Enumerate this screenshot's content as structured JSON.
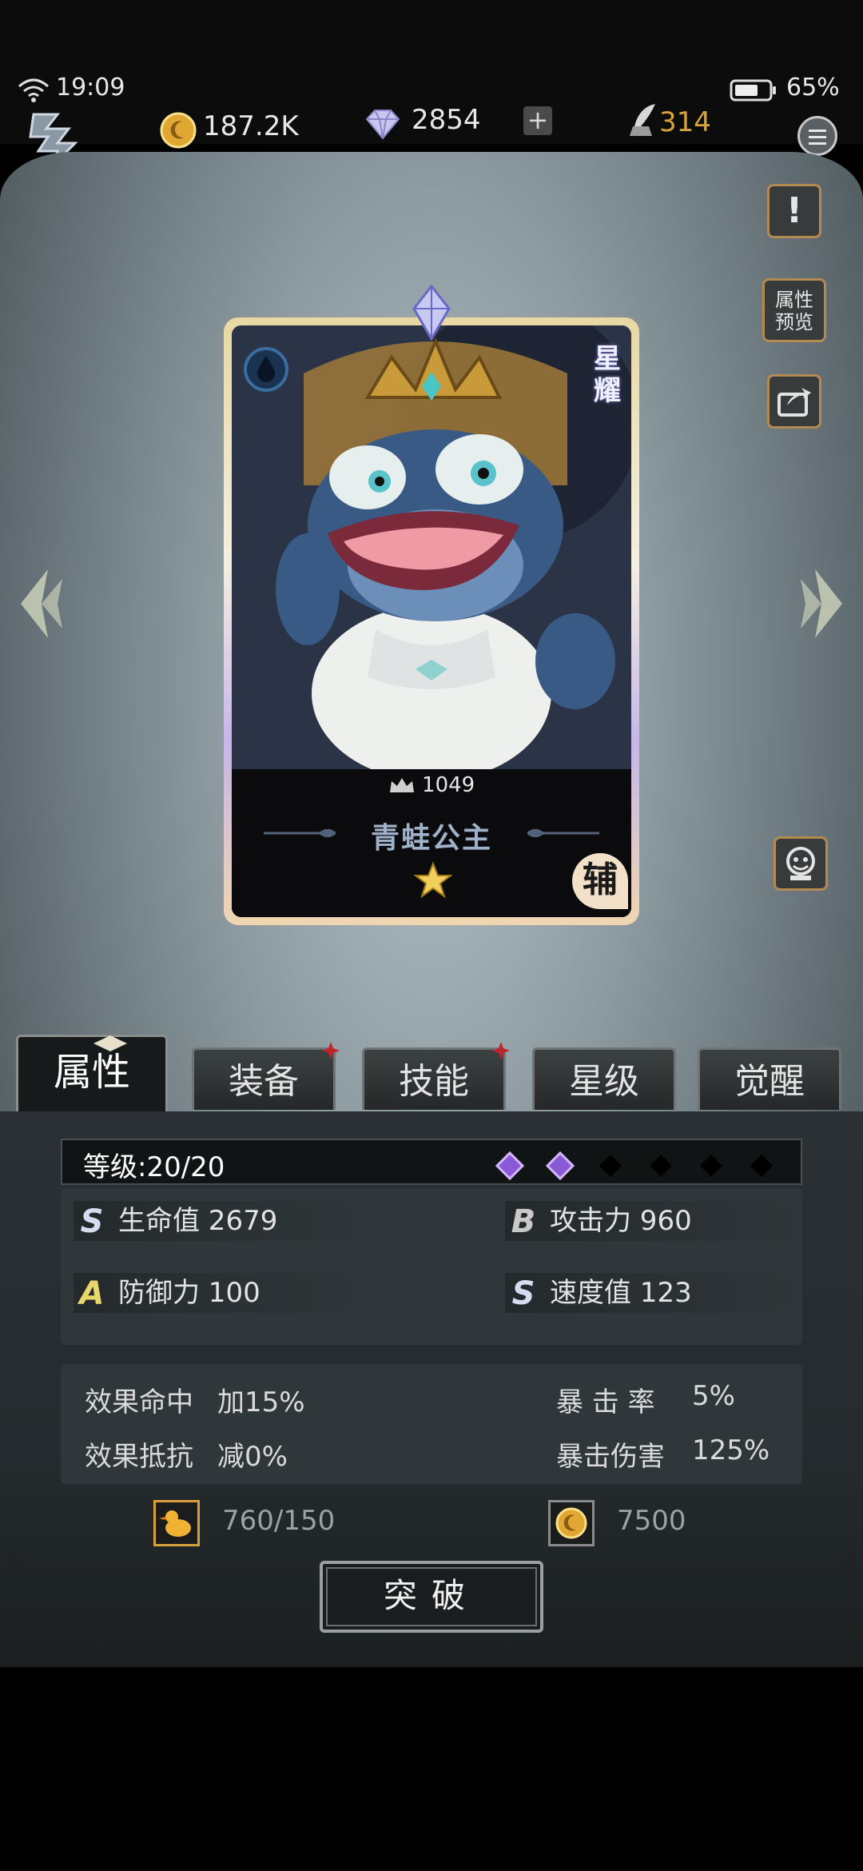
{
  "status_bar": {
    "time": "19:09",
    "battery": "65%"
  },
  "currency": {
    "gold": "187.2K",
    "gems": "2854",
    "add_label": "+",
    "stamina": "314"
  },
  "side_buttons": {
    "info_label": "!",
    "preview_label": "属性\n预览"
  },
  "hero": {
    "name": "青蛙公主",
    "power": "1049",
    "rarity_badge": "星耀",
    "role": "辅",
    "stars": 1,
    "element": "water"
  },
  "tabs": [
    {
      "label": "属性",
      "active": true,
      "badge": false
    },
    {
      "label": "装备",
      "active": false,
      "badge": true
    },
    {
      "label": "技能",
      "active": false,
      "badge": true
    },
    {
      "label": "星级",
      "active": false,
      "badge": false
    },
    {
      "label": "觉醒",
      "active": false,
      "badge": false
    }
  ],
  "level": {
    "label": "等级:20/20",
    "gems_filled": 2,
    "gems_total": 6
  },
  "stats": [
    {
      "grade": "S",
      "label": "生命值 2679"
    },
    {
      "grade": "B",
      "label": "攻击力 960"
    },
    {
      "grade": "A",
      "label": "防御力 100"
    },
    {
      "grade": "S",
      "label": "速度值 123"
    }
  ],
  "extra_stats": [
    {
      "label": "效果命中",
      "value": "加15%"
    },
    {
      "label": "暴 击 率",
      "value": "5%"
    },
    {
      "label": "效果抵抗",
      "value": "减0%"
    },
    {
      "label": "暴击伤害",
      "value": "125%"
    }
  ],
  "costs": {
    "material": "760/150",
    "gold": "7500"
  },
  "breakthrough_label": "突破",
  "colors": {
    "accent_gold": "#d8a23c",
    "badge_red": "#c0242a",
    "gem_purple": "#8a5ad6"
  }
}
